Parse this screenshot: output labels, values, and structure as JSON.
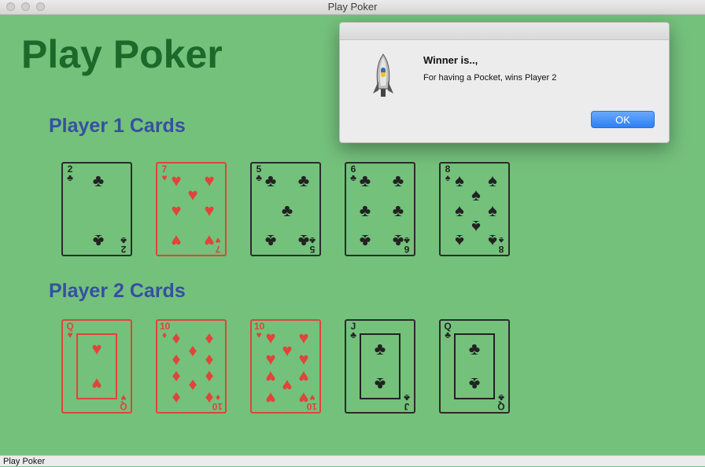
{
  "window": {
    "title": "Play Poker"
  },
  "main": {
    "heading": "Play Poker"
  },
  "players": [
    {
      "label": "Player 1 Cards",
      "cards": [
        {
          "rank": "2",
          "suit": "♣",
          "color": "black",
          "name": "card-2-of-clubs"
        },
        {
          "rank": "7",
          "suit": "♥",
          "color": "red",
          "name": "card-7-of-hearts"
        },
        {
          "rank": "5",
          "suit": "♣",
          "color": "black",
          "name": "card-5-of-clubs"
        },
        {
          "rank": "6",
          "suit": "♣",
          "color": "black",
          "name": "card-6-of-clubs"
        },
        {
          "rank": "8",
          "suit": "♠",
          "color": "black",
          "name": "card-8-of-spades"
        }
      ]
    },
    {
      "label": "Player 2 Cards",
      "cards": [
        {
          "rank": "Q",
          "suit": "♥",
          "color": "red",
          "name": "card-queen-of-hearts"
        },
        {
          "rank": "10",
          "suit": "♦",
          "color": "red",
          "name": "card-10-of-diamonds"
        },
        {
          "rank": "10",
          "suit": "♥",
          "color": "red",
          "name": "card-10-of-hearts"
        },
        {
          "rank": "J",
          "suit": "♣",
          "color": "black",
          "name": "card-jack-of-clubs"
        },
        {
          "rank": "Q",
          "suit": "♣",
          "color": "black",
          "name": "card-queen-of-clubs"
        }
      ]
    }
  ],
  "dialog": {
    "title": "Winner is..,",
    "message": "For having a Pocket, wins Player 2",
    "ok_label": "OK",
    "icon": "python-rocket-icon"
  },
  "statusbar": {
    "text": "Play Poker"
  },
  "colors": {
    "background": "#74c17c",
    "heading": "#1c6a2a",
    "player_label": "#3650a0",
    "red_suit": "#e0443a",
    "black_suit": "#222222",
    "ok_button": "#2e80f4"
  }
}
